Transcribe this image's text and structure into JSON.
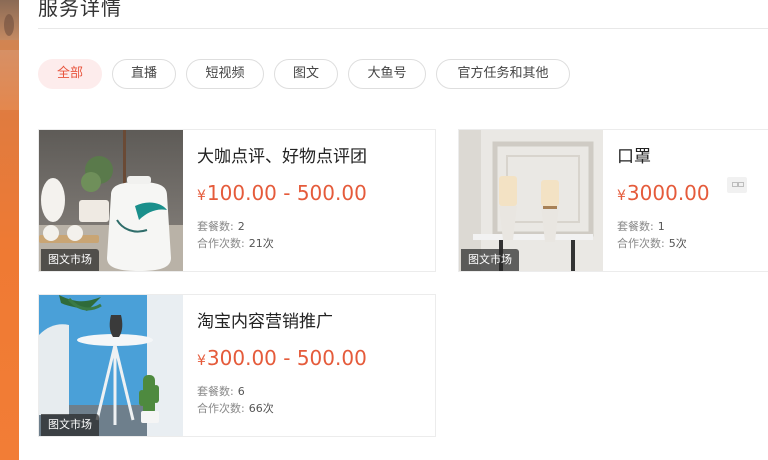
{
  "section": {
    "title": "服务详情"
  },
  "filters": [
    {
      "label": "全部",
      "active": true
    },
    {
      "label": "直播",
      "active": false
    },
    {
      "label": "短视频",
      "active": false
    },
    {
      "label": "图文",
      "active": false
    },
    {
      "label": "大鱼号",
      "active": false
    },
    {
      "label": "官方任务和其他",
      "active": false
    }
  ],
  "labels": {
    "package_count": "套餐数:",
    "coop_count": "合作次数:",
    "currency": "¥"
  },
  "cards": [
    {
      "title": "大咖点评、好物点评团",
      "price": "100.00 - 500.00",
      "packages": "2",
      "cooperations": "21次",
      "badge": "图文市场"
    },
    {
      "title": "口罩",
      "price": "3000.00",
      "packages": "1",
      "cooperations": "5次",
      "badge": "图文市场"
    },
    {
      "title": "淘宝内容营销推广",
      "price": "300.00 - 500.00",
      "packages": "6",
      "cooperations": "66次",
      "badge": "图文市场"
    }
  ],
  "colors": {
    "accent": "#e55b3b",
    "active_pill_bg": "#fdecec"
  }
}
